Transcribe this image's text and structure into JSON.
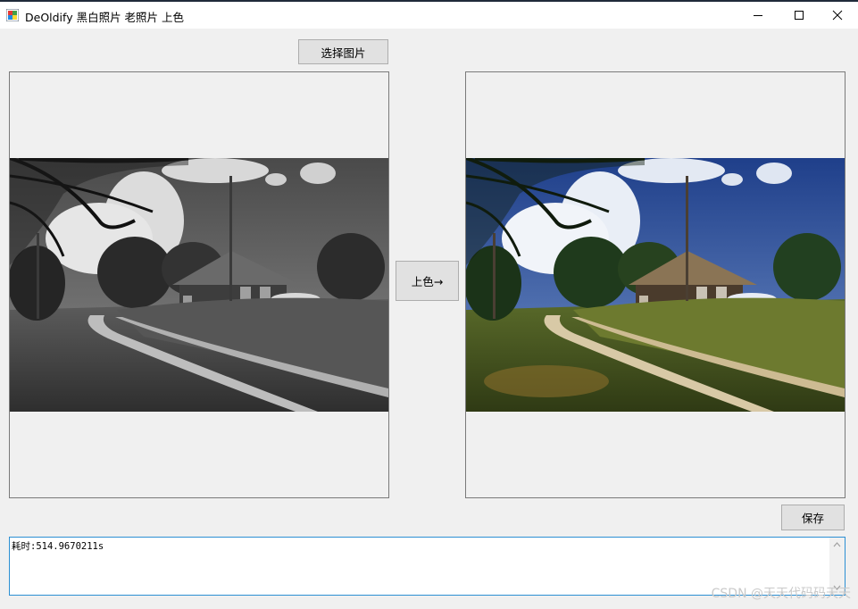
{
  "window": {
    "title": "DeOldify 黑白照片 老照片 上色",
    "icon": "app-icon",
    "controls": [
      "minimize-icon",
      "maximize-icon",
      "close-icon"
    ]
  },
  "toolbar": {
    "select_label": "选择图片"
  },
  "main": {
    "colorize_label": "上色→"
  },
  "footer": {
    "save_label": "保存"
  },
  "log": {
    "text": "耗时:514.9670211s"
  },
  "watermark": {
    "text": "CSDN @天天代码码天天"
  },
  "colors": {
    "accent": "#2b8fd3",
    "window_bg": "#f0f0f0",
    "button_bg": "#e1e1e1",
    "button_border": "#adadad"
  }
}
